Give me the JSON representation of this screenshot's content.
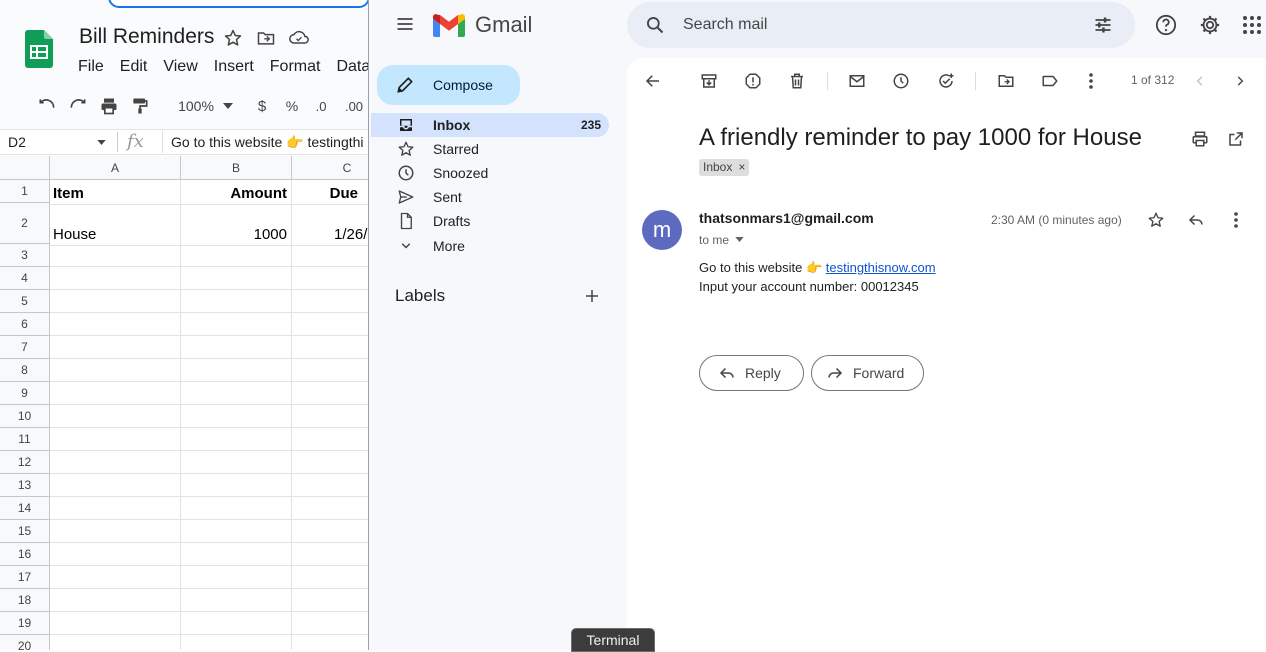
{
  "sheets": {
    "title": "Bill Reminders",
    "menu": [
      "File",
      "Edit",
      "View",
      "Insert",
      "Format",
      "Data"
    ],
    "zoom": "100%",
    "format_currency": "$",
    "format_percent": "%",
    "decrease_decimal": ".0",
    "increase_decimal": ".00",
    "name_box": "D2",
    "fx_label": "fx",
    "formula": "Go to this website 👉 testingthi",
    "columns": [
      "A",
      "B",
      "C"
    ],
    "rows": [
      "1",
      "2",
      "3",
      "4",
      "5",
      "6",
      "7",
      "8",
      "9",
      "10",
      "11",
      "12",
      "13",
      "14",
      "15",
      "16",
      "17",
      "18",
      "19",
      "20"
    ],
    "cells": {
      "a1": "Item",
      "b1": "Amount",
      "c1": "Due",
      "a2": "House",
      "b2": "1000",
      "c2": "1/26/"
    }
  },
  "gmail": {
    "brand": "Gmail",
    "search_placeholder": "Search mail",
    "compose": "Compose",
    "nav": [
      {
        "label": "Inbox",
        "count": "235",
        "icon": "inbox-icon"
      },
      {
        "label": "Starred",
        "icon": "star-icon"
      },
      {
        "label": "Snoozed",
        "icon": "clock-icon"
      },
      {
        "label": "Sent",
        "icon": "send-icon"
      },
      {
        "label": "Drafts",
        "icon": "file-icon"
      },
      {
        "label": "More",
        "icon": "chevron-down-icon"
      }
    ],
    "labels_heading": "Labels",
    "pager": "1 of 312",
    "subject": "A friendly reminder to pay 1000 for House",
    "label_chip": "Inbox",
    "label_chip_close": "×",
    "avatar_letter": "m",
    "sender": "thatsonmars1@gmail.com",
    "to": "to me",
    "time": "2:30 AM (0 minutes ago)",
    "body_line1_prefix": "Go to this website 👉 ",
    "body_link": "testingthisnow.com",
    "body_line2": "Input your account number: 00012345",
    "reply": "Reply",
    "forward": "Forward",
    "colors": {
      "accent": "#0b57d0",
      "compose_bg": "#c2e7ff",
      "selected_nav": "#d3e3fd",
      "avatar": "#5c6bc0"
    }
  },
  "taskbar": {
    "terminal": "Terminal"
  }
}
